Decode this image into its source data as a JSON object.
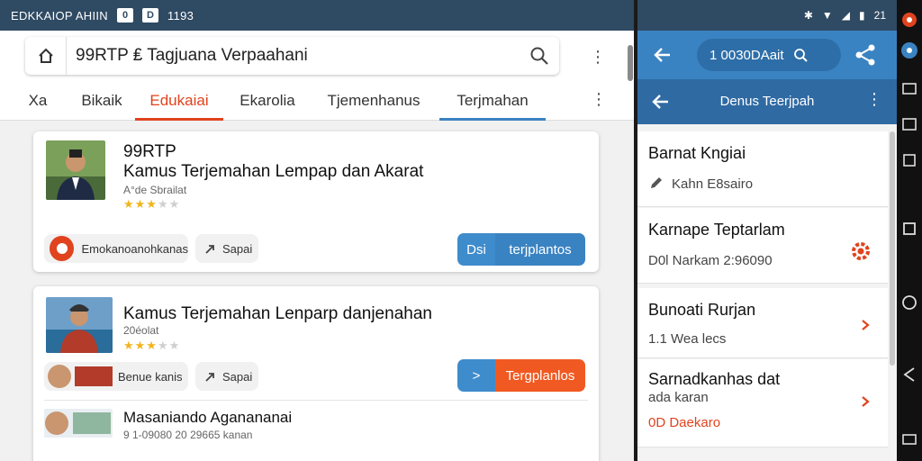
{
  "status_left": {
    "app_name": "EDKKAIOP AHIIN",
    "box1": "0",
    "box2": "D",
    "time": "1193"
  },
  "status_right": {
    "icons": [
      "bluetooth-icon",
      "wifi-icon",
      "signal-icon",
      "battery-icon"
    ],
    "battery_text": "21"
  },
  "search": {
    "query": "99RTP ₤ Tagjuana Verpaahani"
  },
  "tabs": [
    {
      "label": "Xa"
    },
    {
      "label": "Bikaik"
    },
    {
      "label": "Edukaiai"
    },
    {
      "label": "Ekarolia"
    },
    {
      "label": "Tjemenhanus"
    },
    {
      "label": "Terjmahan"
    }
  ],
  "cards": [
    {
      "title": "99RTP",
      "subtitle": "Kamus Terjemahan Lempap dan Akarat",
      "meta": "A°de Sbrailat",
      "rating": 3,
      "pill1": "Emokanoanohkanas",
      "pill2": "Sapai",
      "btn_a": "Dsi",
      "btn_b": "terjplantos"
    },
    {
      "title": "Kamus Terjemahan Lenparp danjenahan",
      "meta": "20éolat",
      "rating": 3,
      "pill1": "Benue kanis",
      "pill2": "Sapai",
      "btn_a": ">",
      "btn_b": "Tergplanlos",
      "sub_title": "Masaniando Aganananai",
      "sub_meta": "9 1-09080 20 29665 kanan"
    }
  ],
  "right": {
    "search_pill_text": "1  0030DAait",
    "subtitle": "Denus Teerjpah",
    "items": [
      {
        "title": "Barnat Kngiai",
        "sub": "Kahn E8sairo"
      },
      {
        "title": "Karnape Teptarlam",
        "sub": "D0l Narkam 2:96090"
      },
      {
        "title": "Bunoati Rurjan",
        "sub": "1.1 Wea lecs"
      },
      {
        "title": "Sarnadkanhas dat",
        "sub": "ada karan",
        "sub2": "0D Daekaro"
      }
    ]
  },
  "colors": {
    "primary": "#3a83c2",
    "accent": "#e0431e",
    "orange": "#f05a22",
    "status": "#2f4a63"
  }
}
